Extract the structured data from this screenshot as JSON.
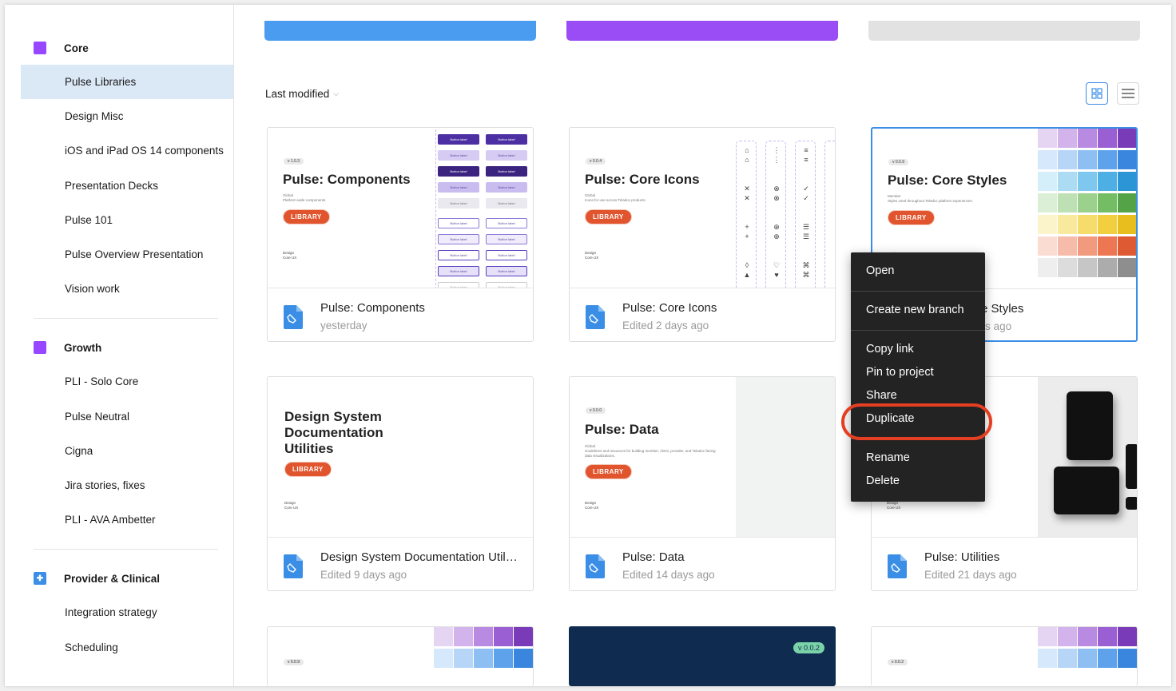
{
  "sidebar": {
    "teams": [
      {
        "label": "Core",
        "items": [
          "Pulse Libraries",
          "Design Misc",
          "iOS and iPad OS 14 components",
          "Presentation Decks",
          "Pulse 101",
          "Pulse Overview Presentation",
          "Vision work"
        ]
      },
      {
        "label": "Growth",
        "items": [
          "PLI - Solo Core",
          "Pulse Neutral",
          "Cigna",
          "Jira stories, fixes",
          "PLI - AVA Ambetter"
        ]
      },
      {
        "label": "Provider & Clinical",
        "items": [
          "Integration strategy",
          "Scheduling"
        ]
      }
    ],
    "active_item": "Pulse Libraries"
  },
  "toolbar": {
    "sort_label": "Last modified",
    "view": "grid"
  },
  "top_bars": [
    "#4a9cf1",
    "#9a4cf5",
    "#e2e2e2"
  ],
  "cards": [
    {
      "name": "Pulse: Components",
      "time": "yesterday",
      "thumb_version": "v 1.0.3",
      "thumb_title": "Pulse: Components",
      "thumb_sub": "Global",
      "thumb_desc": "Platform-wide components.",
      "badge": "LIBRARY",
      "foot1": "Design",
      "foot2": "Core UX",
      "button_label": "Button label"
    },
    {
      "name": "Pulse: Core Icons",
      "time": "Edited 2 days ago",
      "thumb_version": "v 0.0.4",
      "thumb_title": "Pulse: Core Icons",
      "thumb_sub": "Global",
      "thumb_desc": "Icons for use across Teladoc products.",
      "badge": "LIBRARY",
      "foot1": "Design",
      "foot2": "Core UX"
    },
    {
      "name": "Pulse: Core Styles",
      "time": "Edited 2 days ago",
      "thumb_version": "v 0.0.9",
      "thumb_title": "Pulse: Core Styles",
      "thumb_sub": "Member",
      "thumb_desc": "Styles used throughout Teladoc platform experiences.",
      "badge": "LIBRARY",
      "foot1": "Design",
      "foot2": "Core UX"
    },
    {
      "name": "Design System Documentation Utilities",
      "time": "Edited 9 days ago",
      "thumb_title_lines": [
        "Design System",
        "Documentation",
        "Utilities"
      ],
      "badge": "LIBRARY",
      "foot1": "Design",
      "foot2": "Core UX"
    },
    {
      "name": "Pulse: Data",
      "time": "Edited 14 days ago",
      "thumb_version": "v 0.0.0",
      "thumb_title": "Pulse: Data",
      "thumb_sub": "Global",
      "thumb_desc": "Guidelines and resources for building member, client, provider, and Teladoc-facing data visualizations.",
      "badge": "LIBRARY",
      "foot1": "Design",
      "foot2": "Core UX"
    },
    {
      "name": "Pulse: Utilities",
      "time": "Edited 21 days ago",
      "foot1": "Design",
      "foot2": "Core UX"
    }
  ],
  "bottom_cards": [
    {
      "thumb_version": "v 0.0.9"
    },
    {
      "thumb_version": "v 0.0.2"
    },
    {
      "thumb_version": "v 0.0.2"
    }
  ],
  "context_menu": {
    "items": [
      "Open",
      "Create new branch",
      "Copy link",
      "Pin to project",
      "Share",
      "Duplicate",
      "Rename",
      "Delete"
    ],
    "highlighted": "Duplicate"
  },
  "colors": {
    "accent": "#3a8ee6",
    "library_badge": "#e0542e",
    "menu_bg": "#232323",
    "highlight_ring": "#e43f22"
  }
}
